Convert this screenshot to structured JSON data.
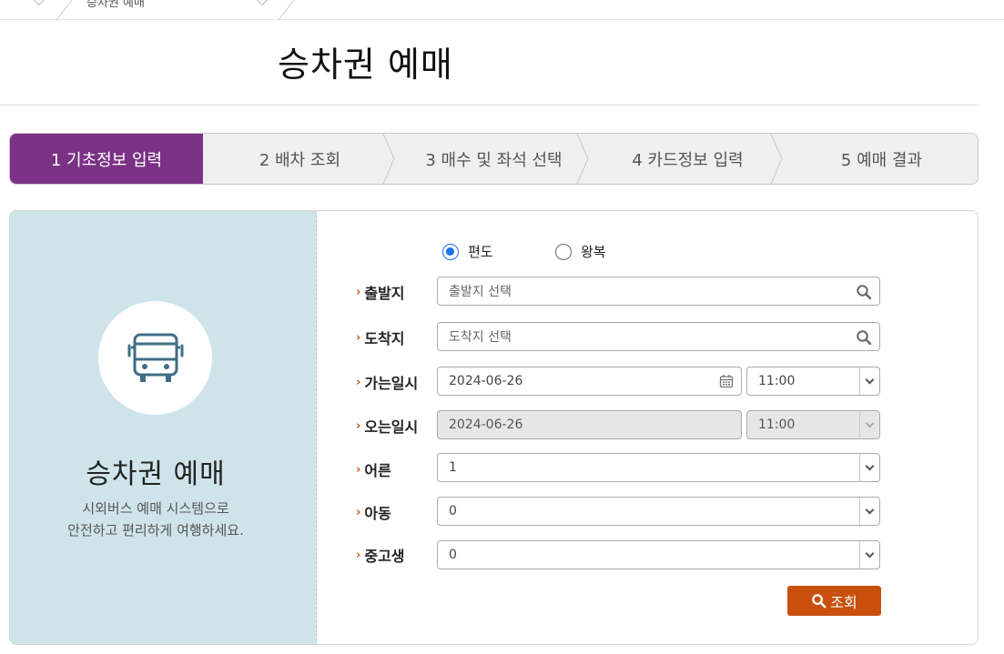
{
  "breadcrumb": {
    "current": "승차권 예매"
  },
  "page": {
    "title": "승차권 예매"
  },
  "steps": [
    {
      "label": "1 기초정보 입력",
      "active": true
    },
    {
      "label": "2 배차 조회",
      "active": false
    },
    {
      "label": "3 매수 및 좌석 선택",
      "active": false
    },
    {
      "label": "4 카드정보 입력",
      "active": false
    },
    {
      "label": "5 예매 결과",
      "active": false
    }
  ],
  "side": {
    "icon": "bus-icon",
    "title": "승차권 예매",
    "desc_line1": "시외버스 예매 시스템으로",
    "desc_line2": "안전하고 편리하게 여행하세요."
  },
  "form": {
    "trip_type": {
      "oneway": "편도",
      "roundtrip": "왕복",
      "selected": "편도"
    },
    "departure": {
      "label": "출발지",
      "placeholder": "출발지 선택"
    },
    "arrival": {
      "label": "도착지",
      "placeholder": "도착지 선택"
    },
    "go_datetime": {
      "label": "가는일시",
      "date": "2024-06-26",
      "time": "11:00"
    },
    "return_datetime": {
      "label": "오는일시",
      "date": "2024-06-26",
      "time": "11:00",
      "disabled": true
    },
    "adult": {
      "label": "어른",
      "value": "1"
    },
    "child": {
      "label": "아동",
      "value": "0"
    },
    "student": {
      "label": "중고생",
      "value": "0"
    },
    "search_button": "조회"
  },
  "colors": {
    "accent_purple": "#7b3185",
    "accent_orange": "#c8500c",
    "side_bg": "#cfe4ea"
  }
}
